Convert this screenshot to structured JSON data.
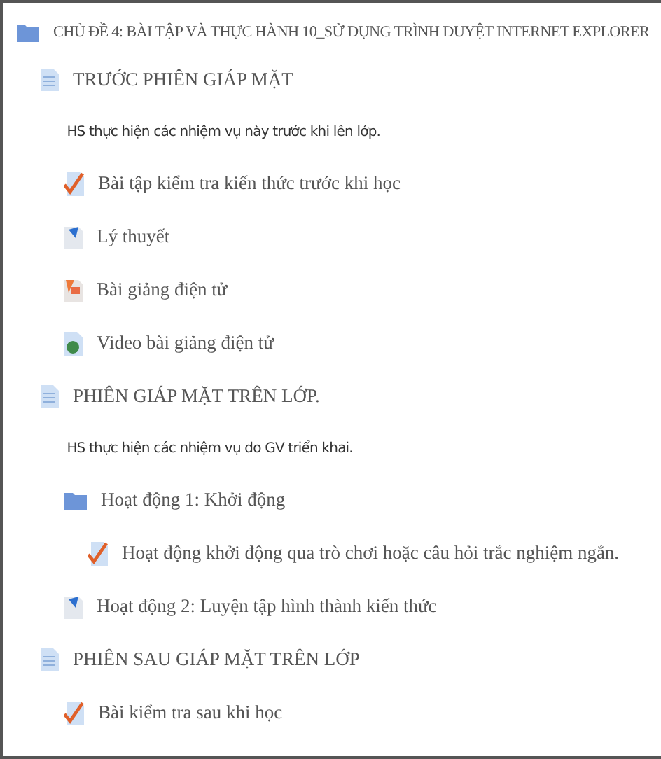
{
  "tree": [
    {
      "kind": "folder",
      "label": "CHỦ ĐỀ 4: BÀI TẬP VÀ THỰC HÀNH 10_SỬ DỤNG TRÌNH DUYỆT INTERNET EXPLORER",
      "children": [
        {
          "kind": "page",
          "label": "TRƯỚC PHIÊN GIÁP MẶT",
          "children": [
            {
              "kind": "text",
              "label": "HS thực hiện các nhiệm vụ này trước khi lên lớp."
            },
            {
              "kind": "quiz",
              "label": "Bài tập kiểm tra kiến thức trước khi học"
            },
            {
              "kind": "lesson",
              "label": "Lý thuyết"
            },
            {
              "kind": "slides",
              "label": "Bài giảng điện tử"
            },
            {
              "kind": "video",
              "label": "Video bài giảng điện tử"
            }
          ]
        },
        {
          "kind": "page",
          "label": "PHIÊN GIÁP MẶT TRÊN LỚP.",
          "children": [
            {
              "kind": "text",
              "label": "HS thực hiện các nhiệm vụ do GV triển khai."
            },
            {
              "kind": "folder",
              "label": "Hoạt động 1: Khởi động",
              "children": [
                {
                  "kind": "quiz",
                  "label": "Hoạt động khởi động qua trò chơi hoặc câu hỏi trắc nghiệm ngắn."
                }
              ]
            },
            {
              "kind": "lesson",
              "label": "Hoạt động 2: Luyện tập hình thành kiến thức"
            }
          ]
        },
        {
          "kind": "page",
          "label": "PHIÊN SAU GIÁP MẶT TRÊN LỚP",
          "children": [
            {
              "kind": "quiz",
              "label": "Bài kiểm tra sau khi học"
            }
          ]
        }
      ]
    }
  ]
}
